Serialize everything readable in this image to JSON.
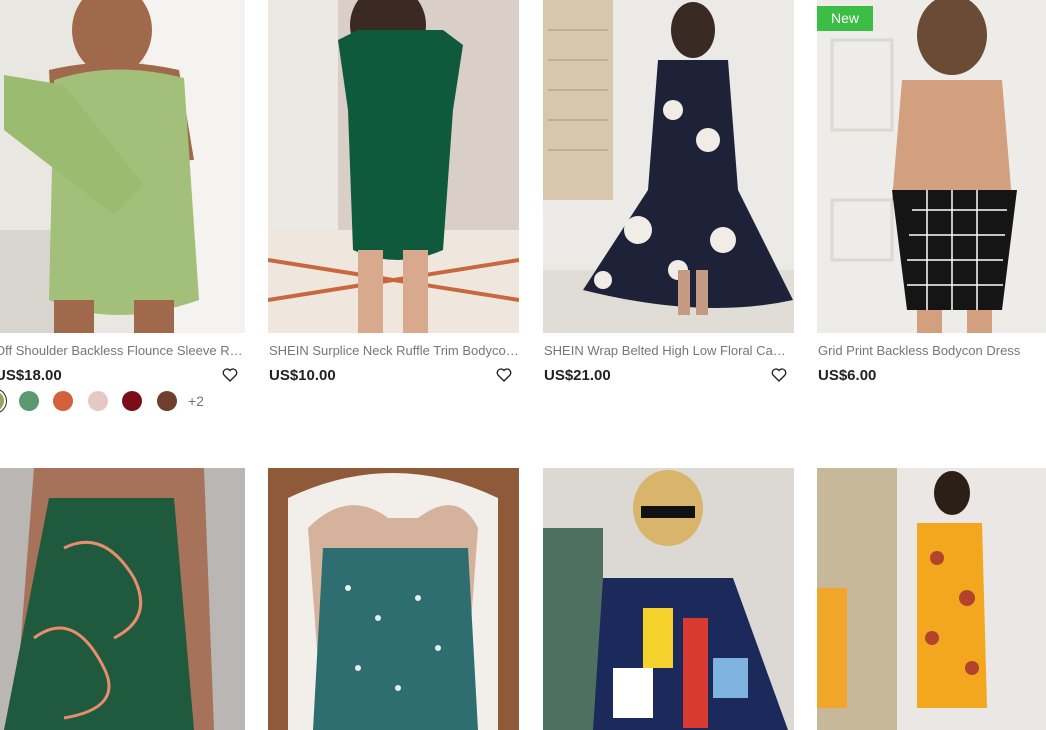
{
  "products": [
    {
      "title": "Off Shoulder Backless Flounce Sleeve Ruched Bodycon Dress",
      "price": "US$18.00",
      "badge": "",
      "swatches": [
        "#8fa65f",
        "#5a9a6f",
        "#d2603a",
        "#e6c8c3",
        "#7b0d18",
        "#6f3f2b"
      ],
      "more": "+2"
    },
    {
      "title": "SHEIN Surplice Neck Ruffle Trim Bodycon Dress",
      "price": "US$10.00",
      "badge": ""
    },
    {
      "title": "SHEIN Wrap Belted High Low Floral Cami Dress",
      "price": "US$21.00",
      "badge": ""
    },
    {
      "title": "Grid Print Backless Bodycon Dress",
      "price": "US$6.00",
      "badge": "New"
    },
    {
      "title": "",
      "price": "",
      "badge": ""
    },
    {
      "title": "",
      "price": "",
      "badge": ""
    },
    {
      "title": "",
      "price": "",
      "badge": ""
    },
    {
      "title": "",
      "price": "",
      "badge": ""
    }
  ],
  "colors": {
    "badge": "#3cbd45",
    "price": "#222222",
    "title": "#767676"
  }
}
